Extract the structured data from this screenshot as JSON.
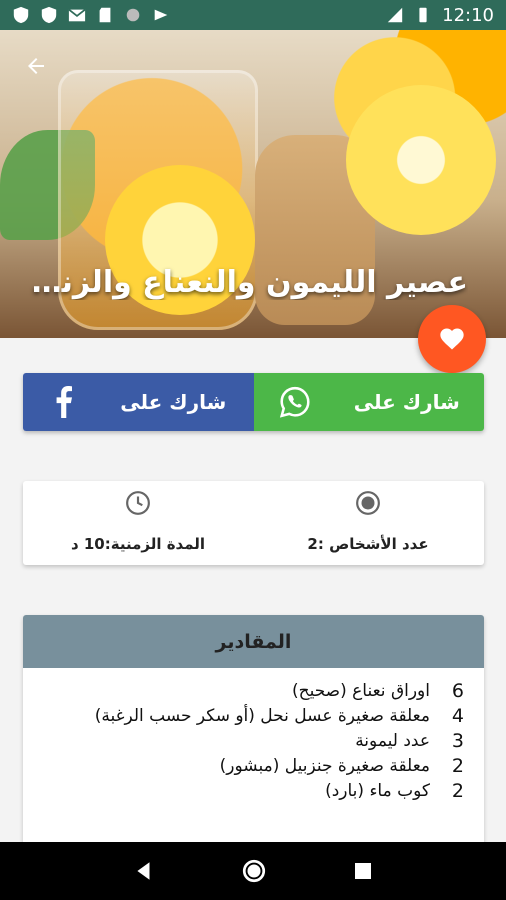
{
  "status_bar": {
    "time": "12:10"
  },
  "hero": {
    "title": "عصير الليمون والنعناع والزنجبيل"
  },
  "share": {
    "whatsapp_label": "شارك على",
    "facebook_label": "شارك على"
  },
  "info": {
    "people_label": "عدد الأشخاص :2",
    "time_label": "المدة الزمنية:10 د"
  },
  "ingredients": {
    "title": "المقادير",
    "items": [
      {
        "qty": "6",
        "text": "اوراق نعناع (صحيح)"
      },
      {
        "qty": "4",
        "text": "معلقة صغيرة عسل نحل (أو سكر حسب الرغبة)"
      },
      {
        "qty": "3",
        "text": "عدد ليمونة"
      },
      {
        "qty": "2",
        "text": "معلقة صغيرة جنزبيل (مبشور)"
      },
      {
        "qty": "2",
        "text": "كوب ماء (بارد)"
      }
    ]
  },
  "colors": {
    "status_bar": "#2f6b5a",
    "facebook": "#3b5ba6",
    "whatsapp": "#4cb748",
    "favorite": "#ff5722",
    "ingredients_header": "#78909c"
  },
  "icons": [
    "arrow-back-icon",
    "heart-icon",
    "whatsapp-icon",
    "facebook-icon",
    "clock-icon",
    "radio-icon",
    "nav-back-icon",
    "nav-home-icon",
    "nav-recents-icon"
  ]
}
